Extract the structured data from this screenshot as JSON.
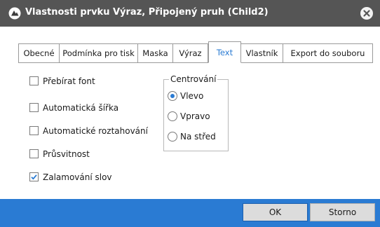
{
  "window": {
    "title": "Vlastnosti prvku Výraz, Připojený pruh (Child2)",
    "close_icon": "close-circle-icon"
  },
  "tabs": [
    {
      "label": "Obecné"
    },
    {
      "label": "Podmínka pro tisk"
    },
    {
      "label": "Maska"
    },
    {
      "label": "Výraz"
    },
    {
      "label": "Text",
      "active": true
    },
    {
      "label": "Vlastník"
    },
    {
      "label": "Export do souboru"
    }
  ],
  "options": [
    {
      "label": "Přebírat font",
      "checked": false
    },
    {
      "label": "Automatická šířka",
      "checked": false
    },
    {
      "label": "Automatické roztahování",
      "checked": false
    },
    {
      "label": "Průsvitnost",
      "checked": false
    },
    {
      "label": "Zalamování slov",
      "checked": true
    }
  ],
  "alignment": {
    "legend": "Centrování",
    "choices": [
      {
        "label": "Vlevo",
        "selected": true
      },
      {
        "label": "Vpravo",
        "selected": false
      },
      {
        "label": "Na střed",
        "selected": false
      }
    ]
  },
  "buttons": {
    "ok": "OK",
    "cancel": "Storno"
  },
  "colors": {
    "titlebar": "#555555",
    "accent": "#2a7bd3",
    "footer": "#2a7bd3"
  }
}
